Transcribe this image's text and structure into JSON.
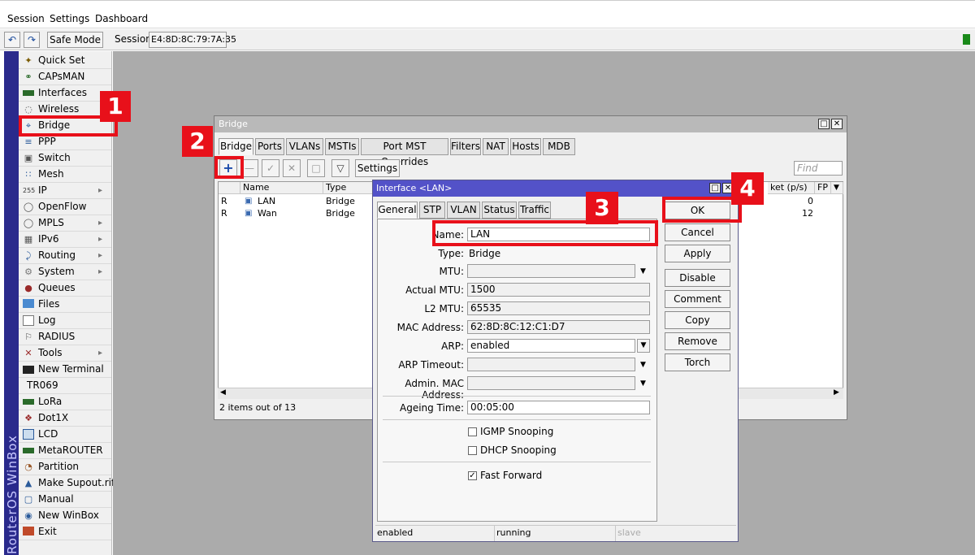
{
  "menu": {
    "session": "Session",
    "settings": "Settings",
    "dashboard": "Dashboard"
  },
  "toolbar": {
    "safe_mode": "Safe Mode",
    "session_label": "Session:",
    "session_value": "E4:8D:8C:79:7A:35"
  },
  "side_brand": "RouterOS WinBox",
  "sidebar": {
    "items": [
      {
        "label": "Quick Set",
        "icon": "wand-icon"
      },
      {
        "label": "CAPsMAN",
        "icon": "antenna-icon"
      },
      {
        "label": "Interfaces",
        "icon": "interfaces-icon"
      },
      {
        "label": "Wireless",
        "icon": "wireless-icon"
      },
      {
        "label": "Bridge",
        "icon": "bridge-icon"
      },
      {
        "label": "PPP",
        "icon": "ppp-icon"
      },
      {
        "label": "Switch",
        "icon": "switch-icon"
      },
      {
        "label": "Mesh",
        "icon": "mesh-icon"
      },
      {
        "label": "IP",
        "icon": "ip-icon",
        "arrow": "▸"
      },
      {
        "label": "OpenFlow",
        "icon": "openflow-icon"
      },
      {
        "label": "MPLS",
        "icon": "mpls-icon",
        "arrow": "▸"
      },
      {
        "label": "IPv6",
        "icon": "ipv6-icon",
        "arrow": "▸"
      },
      {
        "label": "Routing",
        "icon": "routing-icon",
        "arrow": "▸"
      },
      {
        "label": "System",
        "icon": "system-icon",
        "arrow": "▸"
      },
      {
        "label": "Queues",
        "icon": "queues-icon"
      },
      {
        "label": "Files",
        "icon": "files-icon"
      },
      {
        "label": "Log",
        "icon": "log-icon"
      },
      {
        "label": "RADIUS",
        "icon": "radius-icon"
      },
      {
        "label": "Tools",
        "icon": "tools-icon",
        "arrow": "▸"
      },
      {
        "label": "New Terminal",
        "icon": "terminal-icon"
      },
      {
        "label": "TR069",
        "icon": ""
      },
      {
        "label": "LoRa",
        "icon": "lora-icon"
      },
      {
        "label": "Dot1X",
        "icon": "dot1x-icon"
      },
      {
        "label": "LCD",
        "icon": "lcd-icon"
      },
      {
        "label": "MetaROUTER",
        "icon": "metarouter-icon"
      },
      {
        "label": "Partition",
        "icon": "partition-icon"
      },
      {
        "label": "Make Supout.rif",
        "icon": "supout-icon"
      },
      {
        "label": "Manual",
        "icon": "manual-icon"
      },
      {
        "label": "New WinBox",
        "icon": "winbox-icon"
      },
      {
        "label": "Exit",
        "icon": "exit-icon"
      }
    ]
  },
  "annotations": {
    "step1": "1",
    "step2": "2",
    "step3": "3",
    "step4": "4"
  },
  "bridge_window": {
    "title": "Bridge",
    "tabs": [
      "Bridge",
      "Ports",
      "VLANs",
      "MSTIs",
      "Port MST Overrides",
      "Filters",
      "NAT",
      "Hosts",
      "MDB"
    ],
    "settings_btn": "Settings",
    "find_placeholder": "Find",
    "columns": {
      "name": "Name",
      "type": "Type",
      "packet": "ket (p/s)",
      "fp": "FP"
    },
    "rows": [
      {
        "flag": "R",
        "name": "LAN",
        "type": "Bridge",
        "packet": "0"
      },
      {
        "flag": "R",
        "name": "Wan",
        "type": "Bridge",
        "packet": "12"
      }
    ],
    "status": "2 items out of 13"
  },
  "interface_dialog": {
    "title": "Interface <LAN>",
    "tabs": [
      "General",
      "STP",
      "VLAN",
      "Status",
      "Traffic"
    ],
    "fields": {
      "name_label": "Name:",
      "name_value": "LAN",
      "type_label": "Type:",
      "type_value": "Bridge",
      "mtu_label": "MTU:",
      "mtu_value": "",
      "actual_mtu_label": "Actual MTU:",
      "actual_mtu_value": "1500",
      "l2mtu_label": "L2 MTU:",
      "l2mtu_value": "65535",
      "mac_label": "MAC Address:",
      "mac_value": "62:8D:8C:12:C1:D7",
      "arp_label": "ARP:",
      "arp_value": "enabled",
      "arp_timeout_label": "ARP Timeout:",
      "arp_timeout_value": "",
      "admin_mac_label": "Admin. MAC Address:",
      "admin_mac_value": "",
      "ageing_label": "Ageing Time:",
      "ageing_value": "00:05:00"
    },
    "checkboxes": {
      "igmp": {
        "label": "IGMP Snooping",
        "checked": false
      },
      "dhcp": {
        "label": "DHCP Snooping",
        "checked": false
      },
      "fast_forward": {
        "label": "Fast Forward",
        "checked": true
      }
    },
    "buttons": {
      "ok": "OK",
      "cancel": "Cancel",
      "apply": "Apply",
      "disable": "Disable",
      "comment": "Comment",
      "copy": "Copy",
      "remove": "Remove",
      "torch": "Torch"
    },
    "status": {
      "enabled": "enabled",
      "running": "running",
      "slave": "slave"
    }
  },
  "colors": {
    "annotation_red": "#e8101a",
    "dialog_title": "#5352c8",
    "desktop": "#ababab",
    "side_strip": "#2a2a8c"
  }
}
